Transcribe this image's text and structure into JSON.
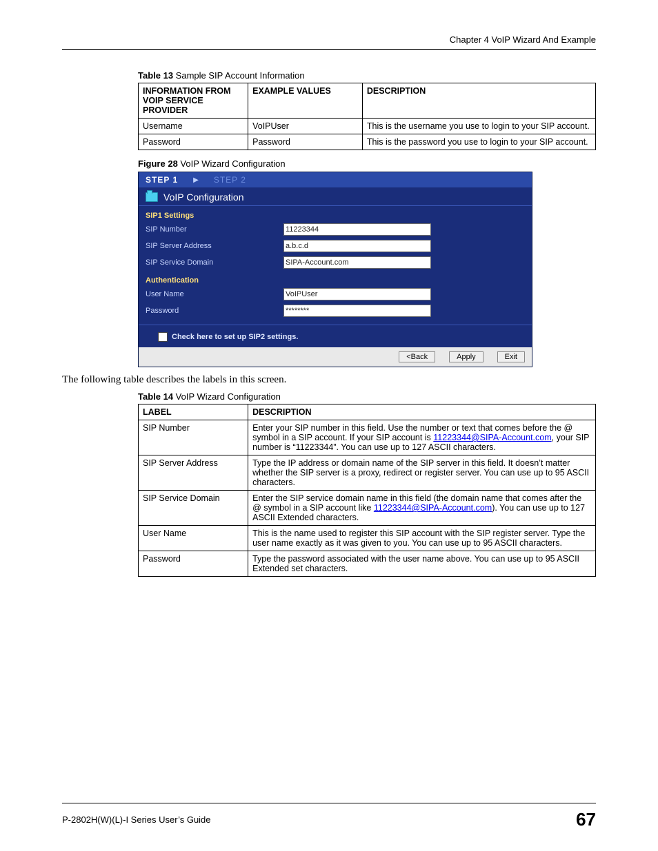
{
  "header": {
    "chapter": "Chapter 4 VoIP Wizard And Example"
  },
  "table13": {
    "caption_bold": "Table 13",
    "caption_rest": "   Sample SIP Account Information",
    "head": {
      "c1": "INFORMATION FROM VOIP SERVICE PROVIDER",
      "c2": "EXAMPLE VALUES",
      "c3": "DESCRIPTION"
    },
    "rows": [
      {
        "c1": "Username",
        "c2": "VoIPUser",
        "c3": "This is the username you use to login to your SIP account."
      },
      {
        "c1": "Password",
        "c2": "Password",
        "c3": "This is the password you use to login to your SIP account."
      }
    ]
  },
  "figure28": {
    "caption_bold": "Figure 28",
    "caption_rest": "   VoIP Wizard Configuration"
  },
  "wizard": {
    "steps": {
      "s1": "STEP 1",
      "s2": "STEP 2"
    },
    "title": "VoIP Configuration",
    "sip1_heading": "SIP1   Settings",
    "fields": {
      "sip_number": {
        "label": "SIP Number",
        "value": "11223344"
      },
      "sip_server": {
        "label": "SIP Server Address",
        "value": "a.b.c.d"
      },
      "sip_domain": {
        "label": "SIP Service Domain",
        "value": "SIPA-Account.com"
      }
    },
    "auth_heading": "Authentication",
    "auth": {
      "user": {
        "label": "User Name",
        "value": "VoIPUser"
      },
      "pass": {
        "label": "Password",
        "value": "********"
      }
    },
    "sip2_check_label": "Check here to set up SIP2 settings.",
    "buttons": {
      "back": "<Back",
      "apply": "Apply",
      "exit": "Exit"
    }
  },
  "body_text": "The following table describes the labels in this screen.",
  "table14": {
    "caption_bold": "Table 14",
    "caption_rest": "   VoIP Wizard Configuration",
    "head": {
      "c1": "LABEL",
      "c2": "DESCRIPTION"
    },
    "rows": [
      {
        "c1": "SIP Number",
        "pre": "Enter your SIP number in this field. Use the number or text that comes before the @ symbol in a SIP account. If your SIP account is ",
        "link": "11223344@SIPA-Account.com",
        "post": ", your SIP number is “11223344”.  You can use up to 127 ASCII characters."
      },
      {
        "c1": "SIP Server Address",
        "plain": "Type the IP address or domain name of the SIP server in this field. It doesn’t matter whether the SIP server is a proxy, redirect or register server. You can use up to 95 ASCII characters."
      },
      {
        "c1": "SIP Service Domain",
        "pre": "Enter the SIP service domain name in this field (the domain name that comes after the @ symbol in a SIP account like ",
        "link": "11223344@SIPA-Account.com",
        "post": "). You can use up to 127 ASCII Extended characters."
      },
      {
        "c1": "User Name",
        "plain": "This is the  name used to register this SIP account with the SIP register server. Type the user name exactly as it was given to you. You can use up to 95 ASCII characters."
      },
      {
        "c1": "Password",
        "plain": "Type the password associated with the user name above. You can use up to 95 ASCII Extended set characters."
      }
    ]
  },
  "footer": {
    "left": "P-2802H(W)(L)-I Series User’s Guide",
    "page": "67"
  }
}
